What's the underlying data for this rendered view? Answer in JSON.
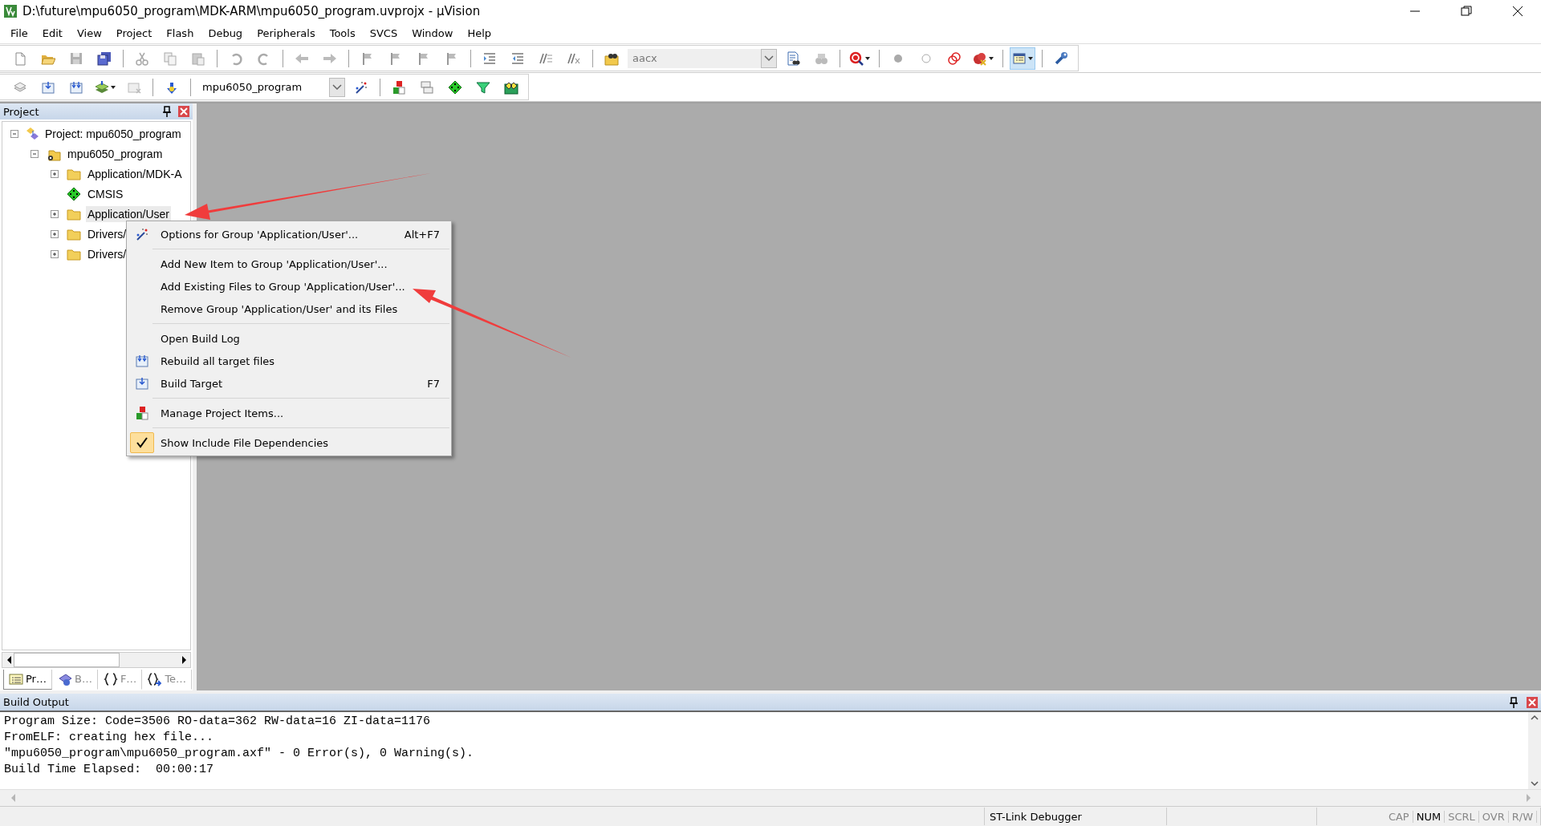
{
  "window": {
    "title": "D:\\future\\mpu6050_program\\MDK-ARM\\mpu6050_program.uvprojx - µVision"
  },
  "menu": [
    "File",
    "Edit",
    "View",
    "Project",
    "Flash",
    "Debug",
    "Peripherals",
    "Tools",
    "SVCS",
    "Window",
    "Help"
  ],
  "toolbar_1": {
    "find_field": {
      "value": "aacx"
    }
  },
  "toolbar_2": {
    "target_select": {
      "value": "mpu6050_program"
    }
  },
  "project_panel": {
    "title": "Project",
    "tree": [
      {
        "label": "Project: mpu6050_program",
        "kind": "project",
        "expanded": true,
        "selected": false,
        "children": [
          {
            "label": "mpu6050_program",
            "kind": "target",
            "expanded": true,
            "selected": false,
            "children": [
              {
                "label": "Application/MDK-A",
                "kind": "folder",
                "expanded": false,
                "selected": false
              },
              {
                "label": "CMSIS",
                "kind": "component",
                "selected": false
              },
              {
                "label": "Application/User",
                "kind": "folder",
                "expanded": false,
                "selected": true
              },
              {
                "label": "Drivers/",
                "kind": "folder",
                "expanded": false,
                "selected": false
              },
              {
                "label": "Drivers/",
                "kind": "folder",
                "expanded": false,
                "selected": false
              }
            ]
          }
        ]
      }
    ],
    "tabs": [
      {
        "label": "Pr…",
        "selected": true
      },
      {
        "label": "B…",
        "selected": false
      },
      {
        "label": "F…",
        "selected": false
      },
      {
        "label": "Te…",
        "selected": false
      }
    ]
  },
  "context_menu": [
    {
      "kind": "item",
      "label": "Options for Group 'Application/User'...",
      "shortcut": "Alt+F7"
    },
    {
      "kind": "separator"
    },
    {
      "kind": "item",
      "label": "Add New  Item to Group 'Application/User'..."
    },
    {
      "kind": "item",
      "label": "Add Existing Files to Group 'Application/User'..."
    },
    {
      "kind": "item",
      "label": "Remove Group 'Application/User' and its Files"
    },
    {
      "kind": "separator"
    },
    {
      "kind": "item",
      "label": "Open Build Log"
    },
    {
      "kind": "item",
      "label": "Rebuild all target files"
    },
    {
      "kind": "item",
      "label": "Build Target",
      "shortcut": "F7"
    },
    {
      "kind": "separator"
    },
    {
      "kind": "item",
      "label": "Manage Project Items..."
    },
    {
      "kind": "separator"
    },
    {
      "kind": "check",
      "label": "Show Include File Dependencies",
      "checked": true
    }
  ],
  "build_output": {
    "title": "Build Output",
    "lines": [
      "Program Size: Code=3506 RO-data=362 RW-data=16 ZI-data=1176",
      "FromELF: creating hex file...",
      "\"mpu6050_program\\mpu6050_program.axf\" - 0 Error(s), 0 Warning(s).",
      "Build Time Elapsed:  00:00:17"
    ]
  },
  "status_bar": {
    "debugger": "ST-Link Debugger",
    "indicators": [
      {
        "label": "CAP",
        "on": false
      },
      {
        "label": "NUM",
        "on": true
      },
      {
        "label": "SCRL",
        "on": false
      },
      {
        "label": "OVR",
        "on": false
      },
      {
        "label": "R/W",
        "on": false
      }
    ]
  }
}
